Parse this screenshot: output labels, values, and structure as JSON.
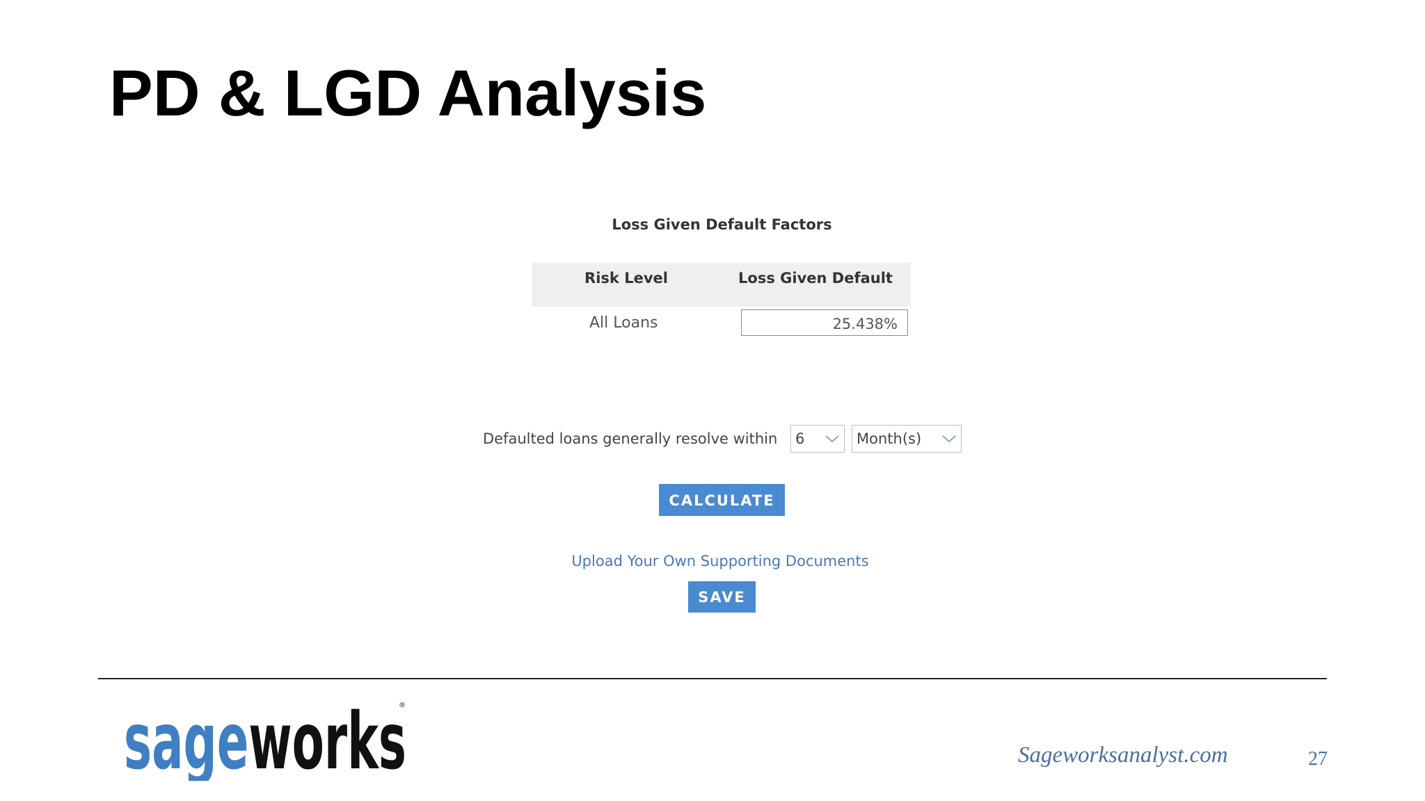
{
  "slide": {
    "title": "PD & LGD Analysis",
    "page_number": "27"
  },
  "lgd_panel": {
    "section_title": "Loss Given Default Factors",
    "columns": [
      "Risk Level",
      "Loss Given Default"
    ],
    "rows": [
      {
        "risk_level": "All Loans",
        "loss_given_default": "25.438%"
      }
    ],
    "resolve_label": "Defaulted loans generally resolve within",
    "resolve_number": "6",
    "resolve_unit": "Month(s)",
    "calculate_label": "CALCULATE",
    "upload_link": "Upload Your Own Supporting Documents",
    "save_label": "SAVE"
  },
  "footer": {
    "logo_text": "sageworks",
    "url": "Sageworksanalyst.com"
  },
  "colors": {
    "button_blue": "#4a8ad0",
    "link_blue": "#4a78b6",
    "logo_blue": "#3f7fc2",
    "logo_black": "#111111",
    "header_gray": "#efefef"
  }
}
